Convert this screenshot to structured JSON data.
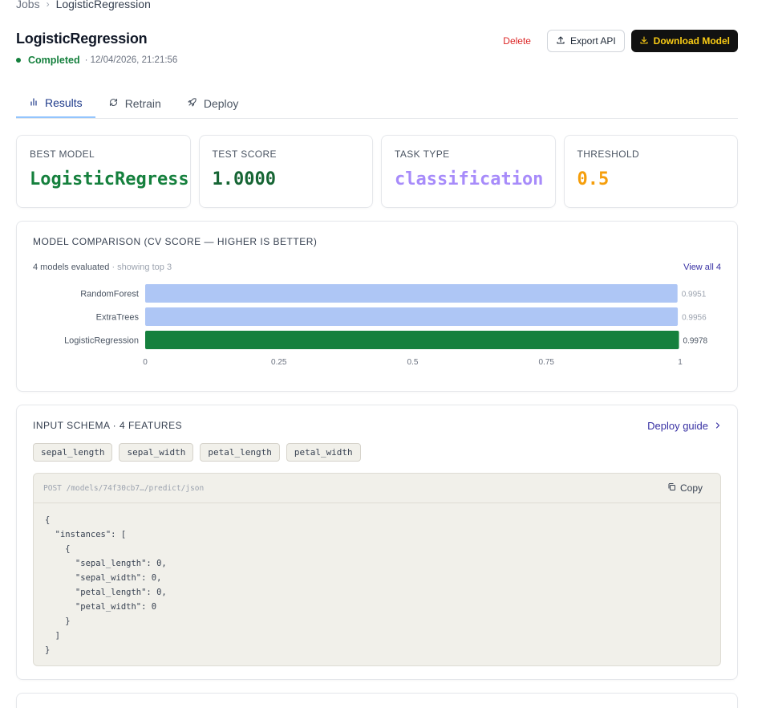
{
  "breadcrumb": {
    "root": "Jobs",
    "current": "LogisticRegression"
  },
  "header": {
    "title": "LogisticRegression",
    "status": "Completed",
    "timestamp": "· 12/04/2026, 21:21:56",
    "actions": {
      "delete": "Delete",
      "export": "Export API",
      "download": "Download Model"
    }
  },
  "tabs": [
    {
      "label": "Results",
      "icon": "bar-chart-icon",
      "active": true
    },
    {
      "label": "Retrain",
      "icon": "refresh-icon",
      "active": false
    },
    {
      "label": "Deploy",
      "icon": "rocket-icon",
      "active": false
    }
  ],
  "stats": [
    {
      "label": "BEST MODEL",
      "value": "LogisticRegression",
      "color": "#15803d"
    },
    {
      "label": "TEST SCORE",
      "value": "1.0000",
      "color": "#166534"
    },
    {
      "label": "TASK TYPE",
      "value": "classification",
      "color": "#a78bfa"
    },
    {
      "label": "THRESHOLD",
      "value": "0.5",
      "color": "#f59e0b"
    }
  ],
  "comparison": {
    "title": "MODEL COMPARISON (CV SCORE — HIGHER IS BETTER)",
    "evaluated": "4 models evaluated",
    "showing": " · showing top 3",
    "view_all": "View all 4"
  },
  "chart_data": {
    "type": "bar",
    "orientation": "horizontal",
    "categories": [
      "RandomForest",
      "ExtraTrees",
      "LogisticRegression"
    ],
    "values": [
      0.9951,
      0.9956,
      0.9978
    ],
    "value_labels": [
      "0.9951",
      "0.9956",
      "0.9978"
    ],
    "highlight": "LogisticRegression",
    "colors": {
      "default": "#aec6f5",
      "highlight": "#15803d"
    },
    "xlim": [
      0,
      1
    ],
    "xticks": [
      "0",
      "0.25",
      "0.5",
      "0.75",
      "1"
    ],
    "title": "",
    "xlabel": "",
    "ylabel": "",
    "grid": false
  },
  "schema": {
    "title": "INPUT SCHEMA · 4 FEATURES",
    "deploy_guide": "Deploy guide",
    "features": [
      "sepal_length",
      "sepal_width",
      "petal_length",
      "petal_width"
    ],
    "endpoint": "POST /models/74f30cb7…/predict/json",
    "copy": "Copy",
    "code": "{\n  \"instances\": [\n    {\n      \"sepal_length\": 0,\n      \"sepal_width\": 0,\n      \"petal_length\": 0,\n      \"petal_width\": 0\n    }\n  ]\n}"
  }
}
